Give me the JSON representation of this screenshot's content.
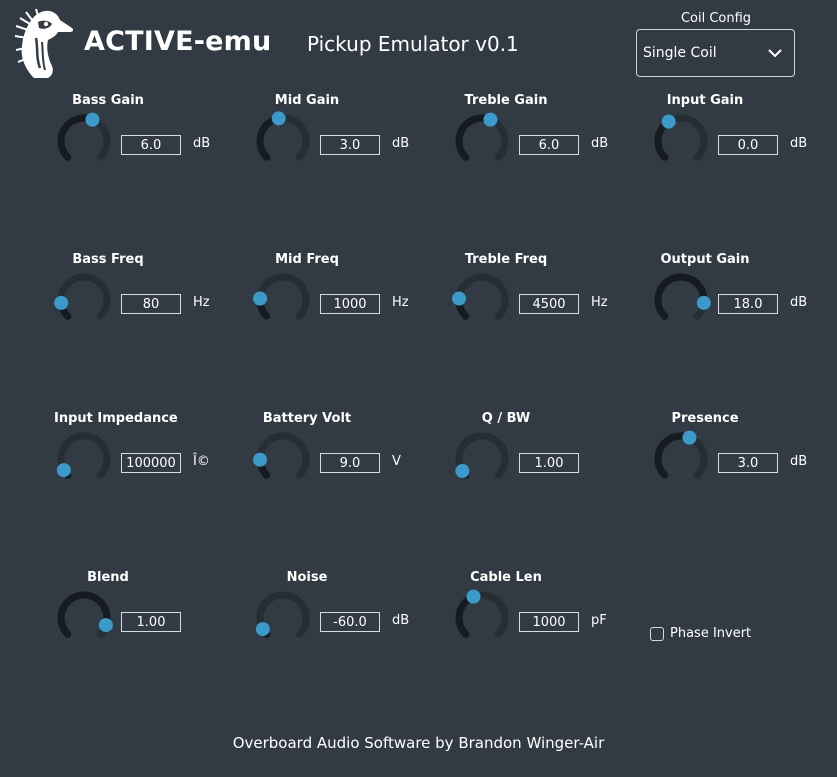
{
  "header": {
    "brand": "ACTIVE-emu",
    "subtitle": "Pickup Emulator v0.1"
  },
  "coil_config": {
    "label": "Coil Config",
    "selected": "Single Coil"
  },
  "controls": [
    {
      "id": "bass-gain",
      "label": "Bass Gain",
      "value": "6.0",
      "unit": "dB",
      "level": 0.58
    },
    {
      "id": "mid-gain",
      "label": "Mid Gain",
      "value": "3.0",
      "unit": "dB",
      "level": 0.46
    },
    {
      "id": "treble-gain",
      "label": "Treble Gain",
      "value": "6.0",
      "unit": "dB",
      "level": 0.58
    },
    {
      "id": "input-gain",
      "label": "Input Gain",
      "value": "0.0",
      "unit": "dB",
      "level": 0.38
    },
    {
      "id": "bass-freq",
      "label": "Bass Freq",
      "value": "80",
      "unit": "Hz",
      "level": 0.14
    },
    {
      "id": "mid-freq",
      "label": "Mid Freq",
      "value": "1000",
      "unit": "Hz",
      "level": 0.18
    },
    {
      "id": "treble-freq",
      "label": "Treble Freq",
      "value": "4500",
      "unit": "Hz",
      "level": 0.18
    },
    {
      "id": "output-gain",
      "label": "Output Gain",
      "value": "18.0",
      "unit": "dB",
      "level": 0.86
    },
    {
      "id": "input-impedance",
      "label": "Input Impedance",
      "value": "100000",
      "unit": "Î©",
      "level": 0.06
    },
    {
      "id": "battery-volt",
      "label": "Battery Volt",
      "value": "9.0",
      "unit": "V",
      "level": 0.16
    },
    {
      "id": "q-bw",
      "label": "Q / BW",
      "value": "1.00",
      "unit": "",
      "level": 0.05
    },
    {
      "id": "presence",
      "label": "Presence",
      "value": "3.0",
      "unit": "dB",
      "level": 0.58
    },
    {
      "id": "blend",
      "label": "Blend",
      "value": "1.00",
      "unit": "",
      "level": 0.9
    },
    {
      "id": "noise",
      "label": "Noise",
      "value": "-60.0",
      "unit": "dB",
      "level": 0.06
    },
    {
      "id": "cable-len",
      "label": "Cable Len",
      "value": "1000",
      "unit": "pF",
      "level": 0.42
    }
  ],
  "phase_invert": {
    "label": "Phase Invert",
    "checked": false
  },
  "footer": "Overboard Audio Software by Brandon Winger-Air",
  "colors": {
    "background": "#323b43",
    "track": "#262e34",
    "fill": "#151b20",
    "accent": "#3a9bcb"
  }
}
